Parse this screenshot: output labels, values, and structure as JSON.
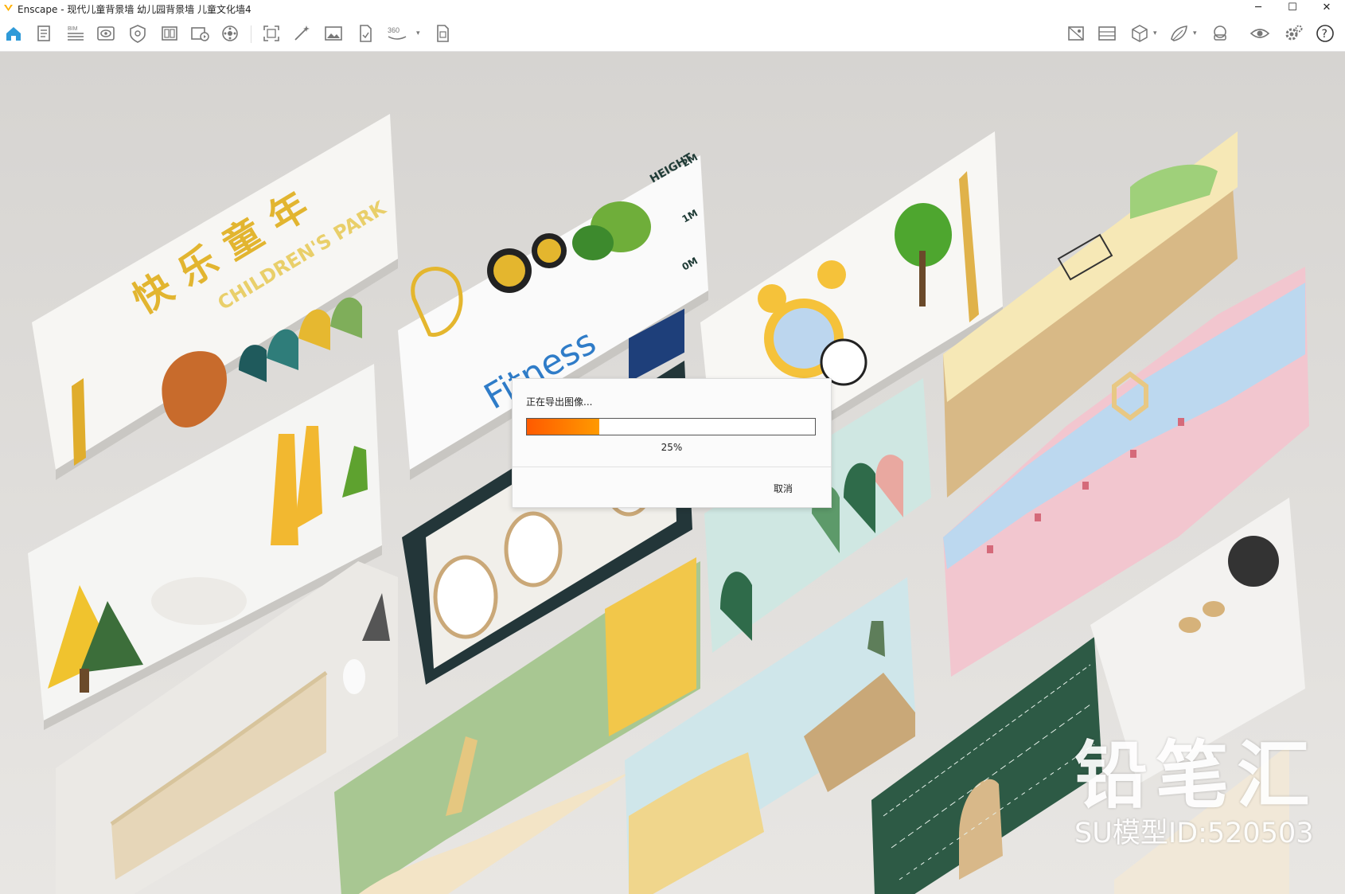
{
  "window": {
    "title": "Enscape - 现代儿童背景墙 幼儿园背景墙 儿童文化墙4",
    "minimize": "─",
    "maximize": "☐",
    "close": "✕"
  },
  "toolbar": {
    "left_icons": [
      "home-icon",
      "document-icon",
      "bim-icon",
      "eye-view-icon",
      "shield-icon",
      "asset-library-icon",
      "video-editor-icon",
      "sun-settings-icon",
      "screenshot-icon",
      "magic-wand-icon",
      "image-icon",
      "export-file-icon",
      "panorama-360-icon",
      "batch-export-icon"
    ],
    "bim_label": "BIM",
    "pano_label": "360",
    "right_icons": [
      "sync-icon",
      "texture-icon",
      "cube-icon",
      "atlas-icon",
      "vr-headset-icon",
      "visibility-icon",
      "settings-icon",
      "help-icon"
    ],
    "accent": "#2f9ad8"
  },
  "dialog": {
    "message": "正在导出图像...",
    "progress": 0.25,
    "percent_label": "25%",
    "cancel_label": "取消",
    "bar_color": "#ff7a00"
  },
  "watermark": {
    "brand": "铅笔汇",
    "model_id": "SU模型ID:520503"
  },
  "scene_text": {
    "wall_cn": "快乐童年",
    "park": "CHILDREN'S PARK",
    "fitness": "Fitness",
    "height": "HEIGHT",
    "m2": "2M",
    "m1": "1M",
    "m0": "0M"
  }
}
